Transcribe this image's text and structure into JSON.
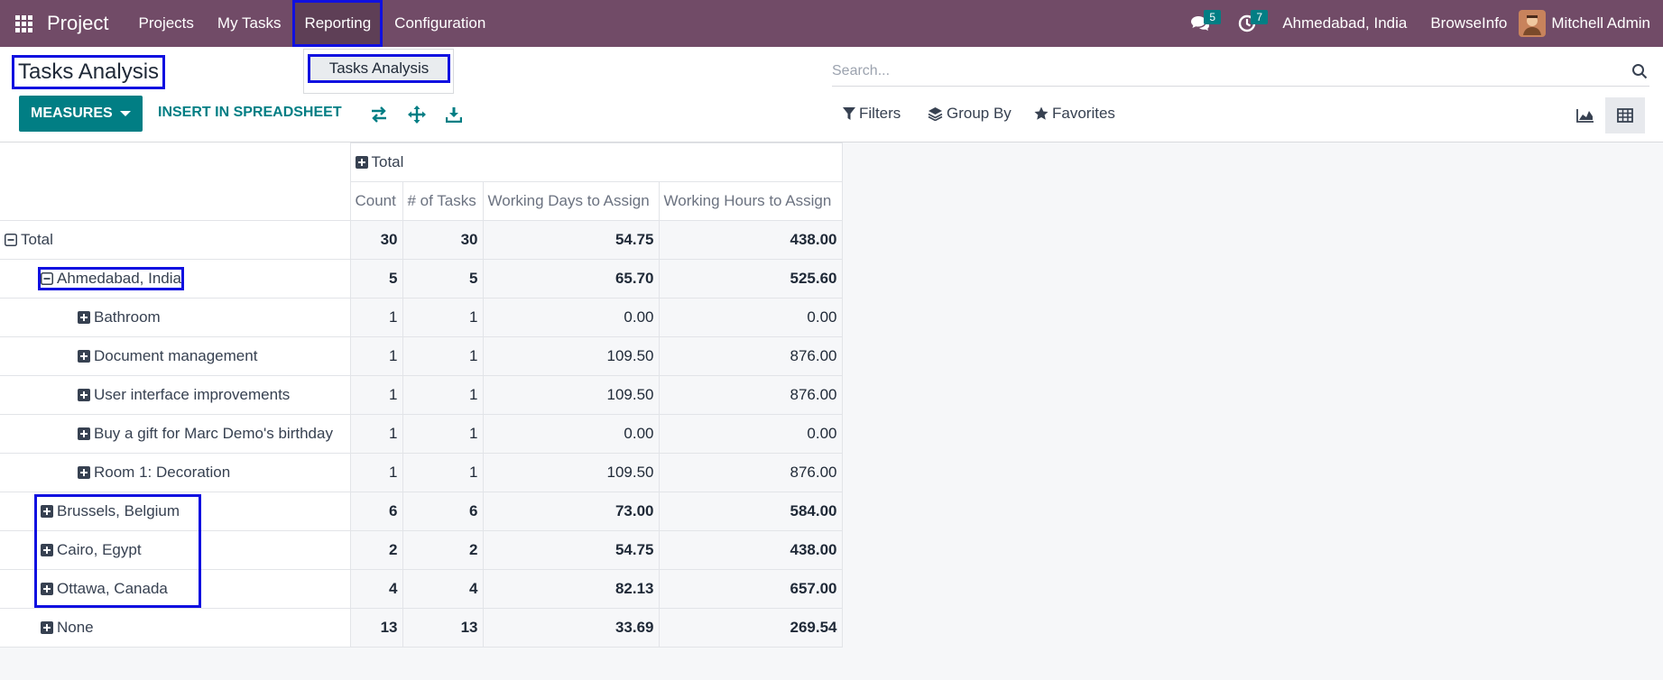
{
  "navbar": {
    "app_name": "Project",
    "menu": [
      "Projects",
      "My Tasks",
      "Reporting",
      "Configuration"
    ],
    "messages_count": "5",
    "activities_count": "7",
    "company": "Ahmedabad, India",
    "database": "BrowseInfo",
    "user": "Mitchell Admin"
  },
  "dropdown": {
    "item": "Tasks Analysis"
  },
  "page": {
    "title": "Tasks Analysis",
    "search_placeholder": "Search...",
    "measures_label": "MEASURES",
    "spreadsheet_label": "INSERT IN SPREADSHEET",
    "filters_label": "Filters",
    "groupby_label": "Group By",
    "favorites_label": "Favorites"
  },
  "pivot": {
    "col_group": "Total",
    "columns": [
      "Count",
      "# of Tasks",
      "Working Days to Assign",
      "Working Hours to Assign"
    ],
    "rows": [
      {
        "label": "Total",
        "values": [
          "30",
          "30",
          "54.75",
          "438.00"
        ]
      },
      {
        "label": "Ahmedabad, India",
        "values": [
          "5",
          "5",
          "65.70",
          "525.60"
        ]
      },
      {
        "label": "Bathroom",
        "values": [
          "1",
          "1",
          "0.00",
          "0.00"
        ]
      },
      {
        "label": "Document management",
        "values": [
          "1",
          "1",
          "109.50",
          "876.00"
        ]
      },
      {
        "label": "User interface improvements",
        "values": [
          "1",
          "1",
          "109.50",
          "876.00"
        ]
      },
      {
        "label": "Buy a gift for Marc Demo's birthday",
        "values": [
          "1",
          "1",
          "0.00",
          "0.00"
        ]
      },
      {
        "label": "Room 1: Decoration",
        "values": [
          "1",
          "1",
          "109.50",
          "876.00"
        ]
      },
      {
        "label": "Brussels, Belgium",
        "values": [
          "6",
          "6",
          "73.00",
          "584.00"
        ]
      },
      {
        "label": "Cairo, Egypt",
        "values": [
          "2",
          "2",
          "54.75",
          "438.00"
        ]
      },
      {
        "label": "Ottawa, Canada",
        "values": [
          "4",
          "4",
          "82.13",
          "657.00"
        ]
      },
      {
        "label": "None",
        "values": [
          "13",
          "13",
          "33.69",
          "269.54"
        ]
      }
    ]
  },
  "colors": {
    "navbar": "#714b67",
    "accent": "#017e84",
    "highlight": "#1010e0"
  }
}
